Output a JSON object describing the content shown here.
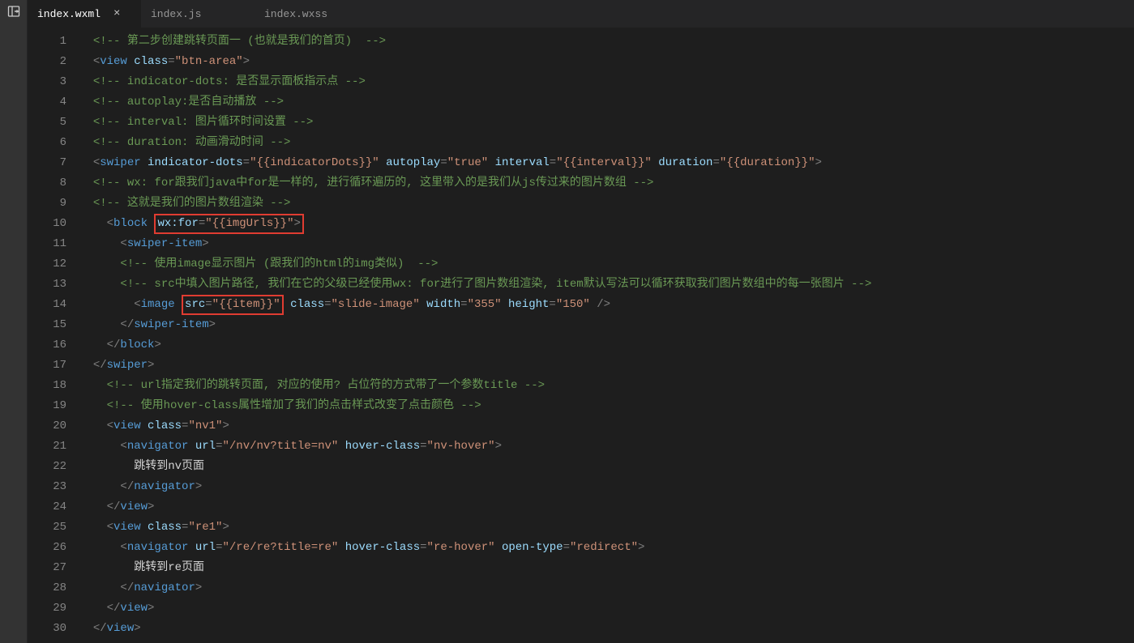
{
  "tabs": [
    {
      "label": "index.wxml",
      "active": true,
      "closable": true
    },
    {
      "label": "index.js",
      "active": false,
      "closable": false
    },
    {
      "label": "index.wxss",
      "active": false,
      "closable": false
    }
  ],
  "lineCount": 30,
  "code": {
    "l1": {
      "c1": "<!-- 第二步创建跳转页面一 (也就是我们的首页)  -->"
    },
    "l2": {
      "p1": "<",
      "tag": "view",
      "sp": " ",
      "a1": "class",
      "eq": "=",
      "v1": "\"btn-area\"",
      "p2": ">"
    },
    "l3": {
      "c1": "<!-- indicator-dots: 是否显示面板指示点 -->"
    },
    "l4": {
      "c1": "<!-- autoplay:是否自动播放 -->"
    },
    "l5": {
      "c1": "<!-- interval: 图片循环时间设置 -->"
    },
    "l6": {
      "c1": "<!-- duration: 动画滑动时间 -->"
    },
    "l7": {
      "p1": "<",
      "tag": "swiper",
      "sp": " ",
      "a1": "indicator-dots",
      "eq": "=",
      "v1": "\"{{indicatorDots}}\"",
      "a2": "autoplay",
      "v2": "\"true\"",
      "a3": "interval",
      "v3": "\"{{interval}}\"",
      "a4": "duration",
      "v4": "\"{{duration}}\"",
      "p2": ">"
    },
    "l8": {
      "c1": "<!-- wx: for跟我们java中for是一样的, 进行循环遍历的, 这里带入的是我们从js传过来的图片数组 -->"
    },
    "l9": {
      "c1": "<!-- 这就是我们的图片数组渲染 -->"
    },
    "l10": {
      "p1": "<",
      "tag": "block",
      "sp": " ",
      "a1": "wx:for",
      "eq": "=",
      "v1": "\"{{imgUrls}}\"",
      "p2": ">"
    },
    "l11": {
      "p1": "<",
      "tag": "swiper-item",
      "p2": ">"
    },
    "l12": {
      "c1": "<!-- 使用image显示图片 (跟我们的html的img类似)  -->"
    },
    "l13": {
      "c1": "<!-- src中填入图片路径, 我们在它的父级已经使用wx: for进行了图片数组渲染, item默认写法可以循环获取我们图片数组中的每一张图片 -->"
    },
    "l14": {
      "p1": "<",
      "tag": "image",
      "sp": " ",
      "a1": "src",
      "eq": "=",
      "v1": "\"{{item}}\"",
      "a2": "class",
      "v2": "\"slide-image\"",
      "a3": "width",
      "v3": "\"355\"",
      "a4": "height",
      "v4": "\"150\"",
      "p2": " />"
    },
    "l15": {
      "p1": "</",
      "tag": "swiper-item",
      "p2": ">"
    },
    "l16": {
      "p1": "</",
      "tag": "block",
      "p2": ">"
    },
    "l17": {
      "p1": "</",
      "tag": "swiper",
      "p2": ">"
    },
    "l18": {
      "c1": "<!-- url指定我们的跳转页面, 对应的使用? 占位符的方式带了一个参数title -->"
    },
    "l19": {
      "c1": "<!-- 使用hover-class属性增加了我们的点击样式改变了点击颜色 -->"
    },
    "l20": {
      "p1": "<",
      "tag": "view",
      "sp": " ",
      "a1": "class",
      "eq": "=",
      "v1": "\"nv1\"",
      "p2": ">"
    },
    "l21": {
      "p1": "<",
      "tag": "navigator",
      "sp": " ",
      "a1": "url",
      "eq": "=",
      "v1": "\"/nv/nv?title=nv\"",
      "a2": "hover-class",
      "v2": "\"nv-hover\"",
      "p2": ">"
    },
    "l22": {
      "t": "跳转到nv页面"
    },
    "l23": {
      "p1": "</",
      "tag": "navigator",
      "p2": ">"
    },
    "l24": {
      "p1": "</",
      "tag": "view",
      "p2": ">"
    },
    "l25": {
      "p1": "<",
      "tag": "view",
      "sp": " ",
      "a1": "class",
      "eq": "=",
      "v1": "\"re1\"",
      "p2": ">"
    },
    "l26": {
      "p1": "<",
      "tag": "navigator",
      "sp": " ",
      "a1": "url",
      "eq": "=",
      "v1": "\"/re/re?title=re\"",
      "a2": "hover-class",
      "v2": "\"re-hover\"",
      "a3": "open-type",
      "v3": "\"redirect\"",
      "p2": ">"
    },
    "l27": {
      "t": "跳转到re页面"
    },
    "l28": {
      "p1": "</",
      "tag": "navigator",
      "p2": ">"
    },
    "l29": {
      "p1": "</",
      "tag": "view",
      "p2": ">"
    },
    "l30": {
      "p1": "</",
      "tag": "view",
      "p2": ">"
    }
  },
  "indent": {
    "l1": 1,
    "l2": 1,
    "l3": 1,
    "l4": 1,
    "l5": 1,
    "l6": 1,
    "l7": 1,
    "l8": 1,
    "l9": 1,
    "l10": 2,
    "l11": 3,
    "l12": 3,
    "l13": 3,
    "l14": 4,
    "l15": 3,
    "l16": 2,
    "l17": 1,
    "l18": 2,
    "l19": 2,
    "l20": 2,
    "l21": 3,
    "l22": 4,
    "l23": 3,
    "l24": 2,
    "l25": 2,
    "l26": 3,
    "l27": 4,
    "l28": 3,
    "l29": 2,
    "l30": 1
  }
}
